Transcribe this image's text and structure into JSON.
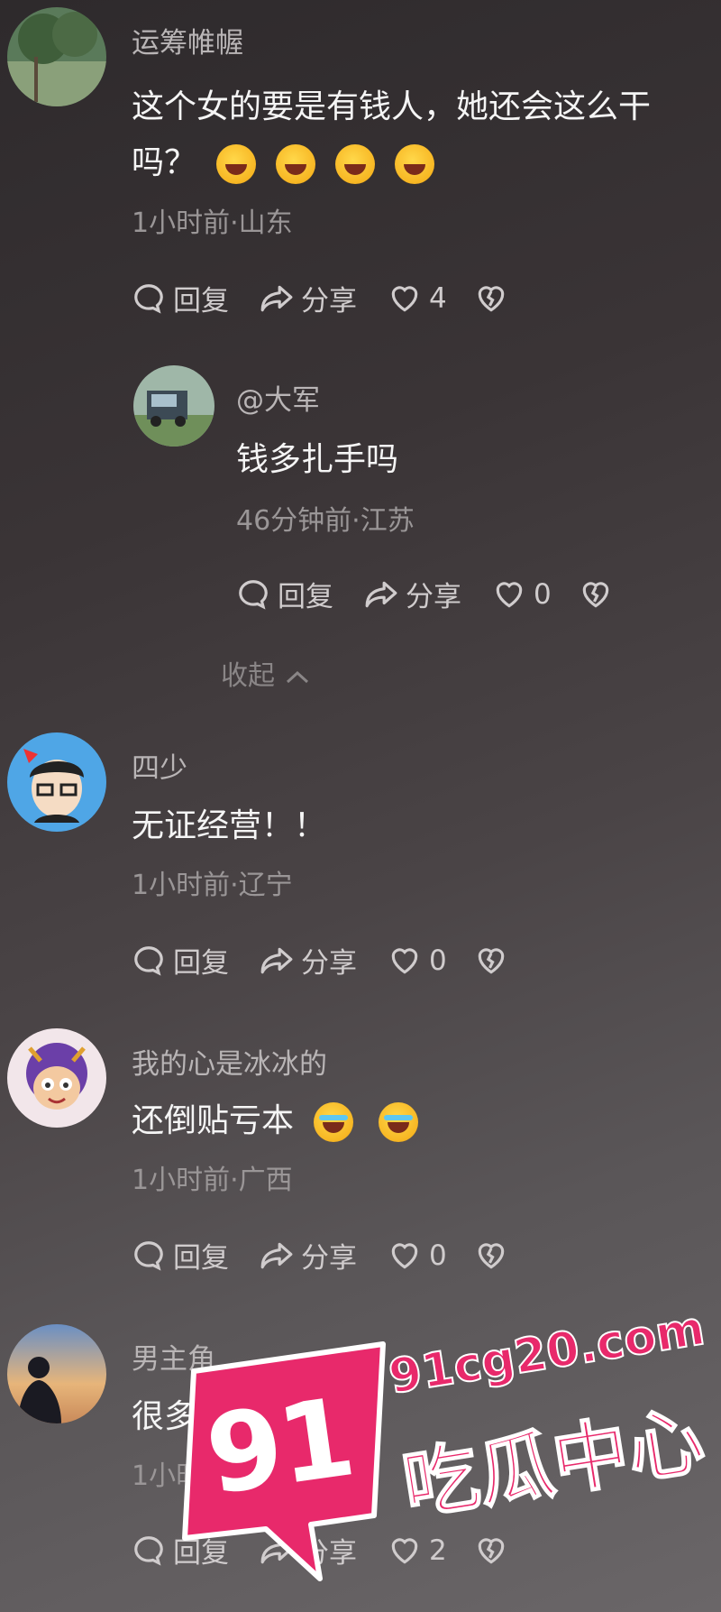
{
  "comments": [
    {
      "username": "运筹帷幄",
      "text_line1": "这个女的要是有钱人，她还会这么干",
      "text_line2": "吗？",
      "meta": "1小时前·山东",
      "reply_label": "回复",
      "share_label": "分享",
      "likes": "4"
    },
    {
      "username": "@大军",
      "text": "钱多扎手吗",
      "meta": "46分钟前·江苏",
      "reply_label": "回复",
      "share_label": "分享",
      "likes": "0"
    },
    {
      "username": "四少",
      "text": "无证经营！！",
      "meta": "1小时前·辽宁",
      "reply_label": "回复",
      "share_label": "分享",
      "likes": "0"
    },
    {
      "username": "我的心是冰冰的",
      "text": "还倒贴亏本",
      "meta": "1小时前·广西",
      "reply_label": "回复",
      "share_label": "分享",
      "likes": "0"
    },
    {
      "username": "男主角",
      "text": "很多这种女得",
      "meta": "1小时前·河南",
      "reply_label": "回复",
      "share_label": "分享",
      "likes": "2"
    }
  ],
  "collapse_label": "收起",
  "watermark": {
    "logo_number": "91",
    "domain": "91cg20.com",
    "site_name": "吃瓜中心",
    "brand_color": "#e8296b"
  },
  "icons": [
    "comment-icon",
    "share-icon",
    "like-heart-icon",
    "dislike-heart-icon",
    "chevron-up-icon",
    "laughing-emoji-icon",
    "crying-emoji-icon"
  ]
}
